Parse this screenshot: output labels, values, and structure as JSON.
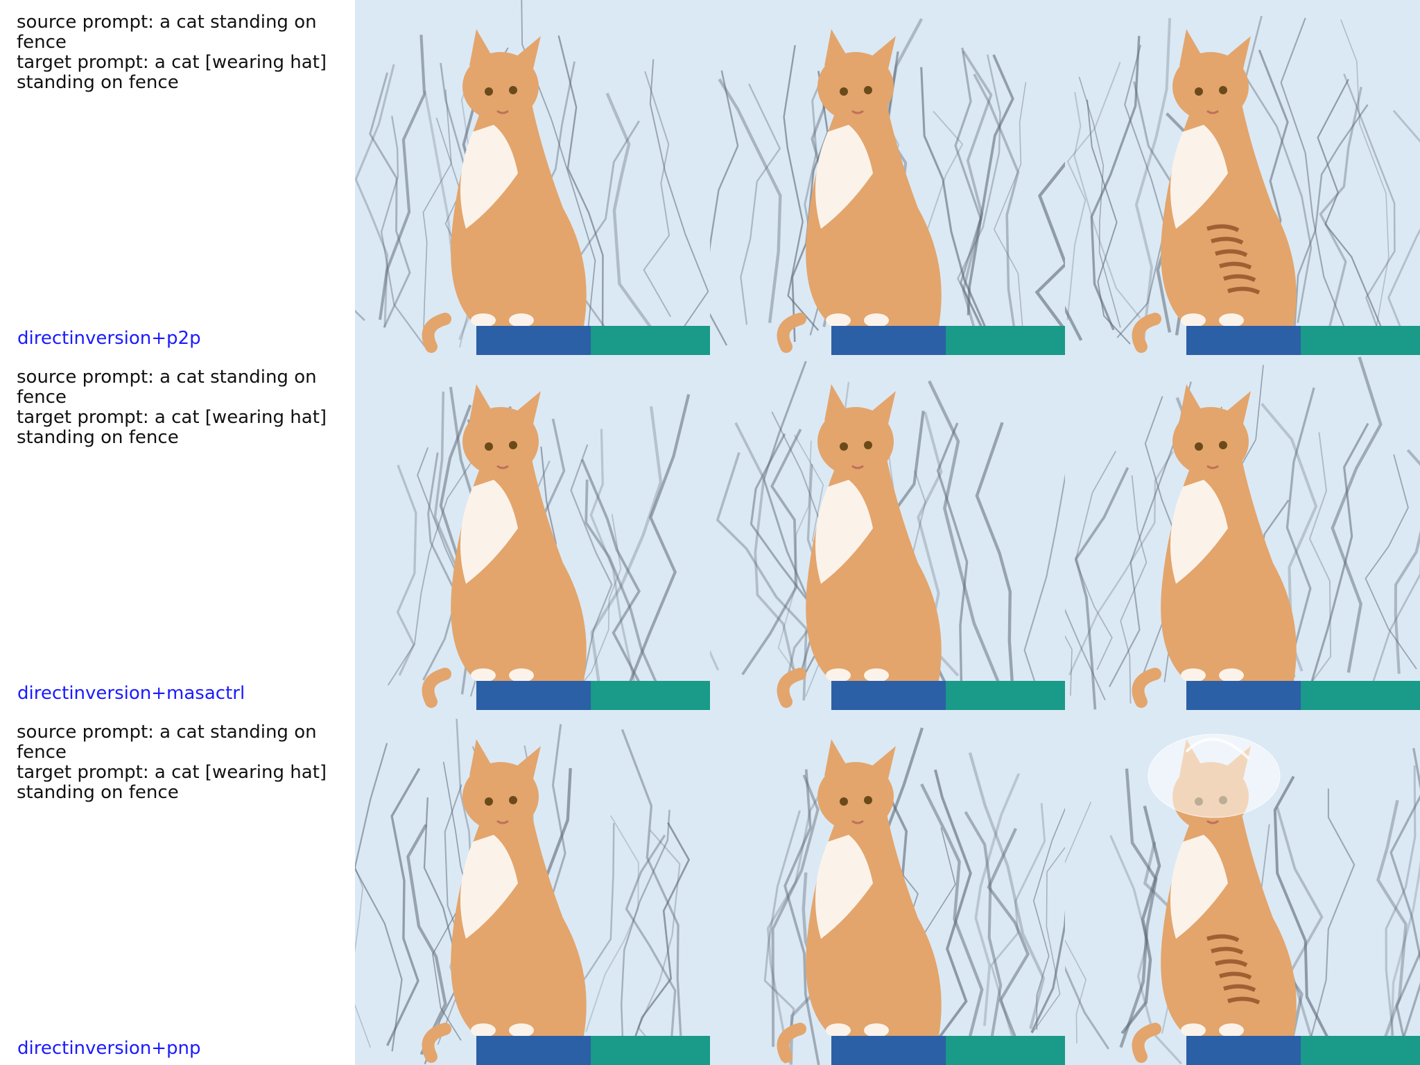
{
  "rows": [
    {
      "source_prompt": "source prompt: a cat standing on fence",
      "target_prompt": "target prompt: a cat [wearing hat] standing on fence",
      "method": "directinversion+p2p",
      "panels": [
        {
          "subject": "orange-white cat on fence",
          "variant": "source",
          "hat": false
        },
        {
          "subject": "orange-white cat on fence",
          "variant": "reconstruction",
          "hat": false
        },
        {
          "subject": "orange-white cat on fence",
          "variant": "edited-striped",
          "hat": false
        }
      ]
    },
    {
      "source_prompt": "source prompt: a cat standing on fence",
      "target_prompt": "target prompt: a cat [wearing hat] standing on fence",
      "method": "directinversion+masactrl",
      "panels": [
        {
          "subject": "orange-white cat on fence",
          "variant": "source",
          "hat": false
        },
        {
          "subject": "orange-white cat on fence",
          "variant": "reconstruction",
          "hat": false
        },
        {
          "subject": "orange-white cat on fence",
          "variant": "edited",
          "hat": false
        }
      ]
    },
    {
      "source_prompt": "source prompt: a cat standing on fence",
      "target_prompt": "target prompt: a cat [wearing hat] standing on fence",
      "method": "directinversion+pnp",
      "panels": [
        {
          "subject": "orange-white cat on fence",
          "variant": "source",
          "hat": false
        },
        {
          "subject": "orange-white cat on fence",
          "variant": "reconstruction",
          "hat": false
        },
        {
          "subject": "orange-white cat on fence",
          "variant": "edited-with-hat",
          "hat": true
        }
      ]
    }
  ],
  "colors": {
    "prompt_text": "#111111",
    "method_text": "#1a1aff",
    "sky": "#dbe9f5",
    "branches": "#5a6470",
    "cat_fur": "#e3a56c",
    "cat_white": "#fbf3ea",
    "fence_blue": "#2b5fa6",
    "fence_teal": "#1a9a88"
  }
}
